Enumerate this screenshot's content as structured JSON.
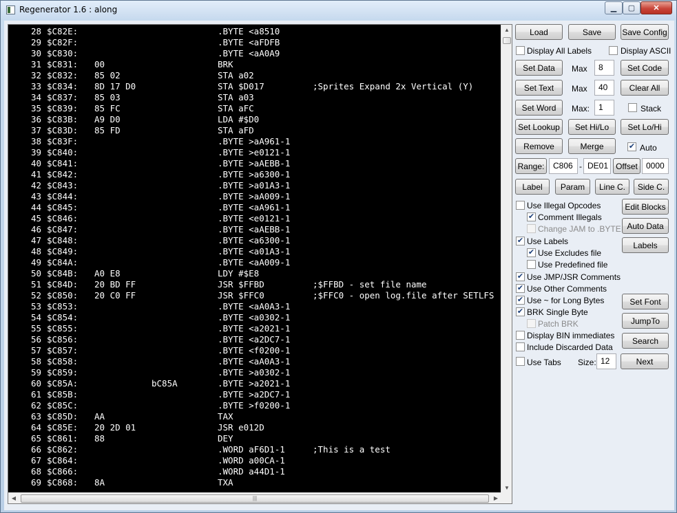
{
  "window": {
    "title": "Regenerator 1.6 : along",
    "min_glyph": "▁",
    "max_glyph": "▢",
    "close_glyph": "✕"
  },
  "code": {
    "lines": [
      {
        "num": "28",
        "addr": "$C82E:",
        "bytes": "",
        "label": "",
        "instr": ".BYTE <a8510",
        "comment": ""
      },
      {
        "num": "29",
        "addr": "$C82F:",
        "bytes": "",
        "label": "",
        "instr": ".BYTE <aFDFB",
        "comment": ""
      },
      {
        "num": "30",
        "addr": "$C830:",
        "bytes": "",
        "label": "",
        "instr": ".BYTE <aA0A9",
        "comment": ""
      },
      {
        "num": "31",
        "addr": "$C831:",
        "bytes": "00",
        "label": "",
        "instr": "BRK",
        "comment": ""
      },
      {
        "num": "32",
        "addr": "$C832:",
        "bytes": "85 02",
        "label": "",
        "instr": "STA a02",
        "comment": ""
      },
      {
        "num": "33",
        "addr": "$C834:",
        "bytes": "8D 17 D0",
        "label": "",
        "instr": "STA $D017",
        "comment": ";Sprites Expand 2x Vertical (Y)"
      },
      {
        "num": "34",
        "addr": "$C837:",
        "bytes": "85 03",
        "label": "",
        "instr": "STA a03",
        "comment": ""
      },
      {
        "num": "35",
        "addr": "$C839:",
        "bytes": "85 FC",
        "label": "",
        "instr": "STA aFC",
        "comment": ""
      },
      {
        "num": "36",
        "addr": "$C83B:",
        "bytes": "A9 D0",
        "label": "",
        "instr": "LDA #$D0",
        "comment": ""
      },
      {
        "num": "37",
        "addr": "$C83D:",
        "bytes": "85 FD",
        "label": "",
        "instr": "STA aFD",
        "comment": ""
      },
      {
        "num": "38",
        "addr": "$C83F:",
        "bytes": "",
        "label": "",
        "instr": ".BYTE >aA961-1",
        "comment": ""
      },
      {
        "num": "39",
        "addr": "$C840:",
        "bytes": "",
        "label": "",
        "instr": ".BYTE >e0121-1",
        "comment": ""
      },
      {
        "num": "40",
        "addr": "$C841:",
        "bytes": "",
        "label": "",
        "instr": ".BYTE >aAEBB-1",
        "comment": ""
      },
      {
        "num": "41",
        "addr": "$C842:",
        "bytes": "",
        "label": "",
        "instr": ".BYTE >a6300-1",
        "comment": ""
      },
      {
        "num": "42",
        "addr": "$C843:",
        "bytes": "",
        "label": "",
        "instr": ".BYTE >a01A3-1",
        "comment": ""
      },
      {
        "num": "43",
        "addr": "$C844:",
        "bytes": "",
        "label": "",
        "instr": ".BYTE >aA009-1",
        "comment": ""
      },
      {
        "num": "44",
        "addr": "$C845:",
        "bytes": "",
        "label": "",
        "instr": ".BYTE <aA961-1",
        "comment": ""
      },
      {
        "num": "45",
        "addr": "$C846:",
        "bytes": "",
        "label": "",
        "instr": ".BYTE <e0121-1",
        "comment": ""
      },
      {
        "num": "46",
        "addr": "$C847:",
        "bytes": "",
        "label": "",
        "instr": ".BYTE <aAEBB-1",
        "comment": ""
      },
      {
        "num": "47",
        "addr": "$C848:",
        "bytes": "",
        "label": "",
        "instr": ".BYTE <a6300-1",
        "comment": ""
      },
      {
        "num": "48",
        "addr": "$C849:",
        "bytes": "",
        "label": "",
        "instr": ".BYTE <a01A3-1",
        "comment": ""
      },
      {
        "num": "49",
        "addr": "$C84A:",
        "bytes": "",
        "label": "",
        "instr": ".BYTE <aA009-1",
        "comment": ""
      },
      {
        "num": "50",
        "addr": "$C84B:",
        "bytes": "A0 E8",
        "label": "",
        "instr": "LDY #$E8",
        "comment": ""
      },
      {
        "num": "51",
        "addr": "$C84D:",
        "bytes": "20 BD FF",
        "label": "",
        "instr": "JSR $FFBD",
        "comment": ";$FFBD - set file name"
      },
      {
        "num": "52",
        "addr": "$C850:",
        "bytes": "20 C0 FF",
        "label": "",
        "instr": "JSR $FFC0",
        "comment": ";$FFC0 - open log.file after SETLFS"
      },
      {
        "num": "53",
        "addr": "$C853:",
        "bytes": "",
        "label": "",
        "instr": ".BYTE <aA0A3-1",
        "comment": ""
      },
      {
        "num": "54",
        "addr": "$C854:",
        "bytes": "",
        "label": "",
        "instr": ".BYTE <a0302-1",
        "comment": ""
      },
      {
        "num": "55",
        "addr": "$C855:",
        "bytes": "",
        "label": "",
        "instr": ".BYTE <a2021-1",
        "comment": ""
      },
      {
        "num": "56",
        "addr": "$C856:",
        "bytes": "",
        "label": "",
        "instr": ".BYTE <a2DC7-1",
        "comment": ""
      },
      {
        "num": "57",
        "addr": "$C857:",
        "bytes": "",
        "label": "",
        "instr": ".BYTE <f0200-1",
        "comment": ""
      },
      {
        "num": "58",
        "addr": "$C858:",
        "bytes": "",
        "label": "",
        "instr": ".BYTE <aA0A3-1",
        "comment": ""
      },
      {
        "num": "59",
        "addr": "$C859:",
        "bytes": "",
        "label": "",
        "instr": ".BYTE >a0302-1",
        "comment": ""
      },
      {
        "num": "60",
        "addr": "$C85A:",
        "bytes": "",
        "label": "bC85A",
        "instr": ".BYTE >a2021-1",
        "comment": ""
      },
      {
        "num": "61",
        "addr": "$C85B:",
        "bytes": "",
        "label": "",
        "instr": ".BYTE >a2DC7-1",
        "comment": ""
      },
      {
        "num": "62",
        "addr": "$C85C:",
        "bytes": "",
        "label": "",
        "instr": ".BYTE >f0200-1",
        "comment": ""
      },
      {
        "num": "63",
        "addr": "$C85D:",
        "bytes": "AA",
        "label": "",
        "instr": "TAX",
        "comment": ""
      },
      {
        "num": "64",
        "addr": "$C85E:",
        "bytes": "20 2D 01",
        "label": "",
        "instr": "JSR e012D",
        "comment": ""
      },
      {
        "num": "65",
        "addr": "$C861:",
        "bytes": "88",
        "label": "",
        "instr": "DEY",
        "comment": ""
      },
      {
        "num": "66",
        "addr": "$C862:",
        "bytes": "",
        "label": "",
        "instr": ".WORD aF6D1-1",
        "comment": ";This is a test"
      },
      {
        "num": "67",
        "addr": "$C864:",
        "bytes": "",
        "label": "",
        "instr": ".WORD a00CA-1",
        "comment": ""
      },
      {
        "num": "68",
        "addr": "$C866:",
        "bytes": "",
        "label": "",
        "instr": ".WORD a44D1-1",
        "comment": ""
      },
      {
        "num": "69",
        "addr": "$C868:",
        "bytes": "8A",
        "label": "",
        "instr": "TXA",
        "comment": ""
      }
    ]
  },
  "panel": {
    "load": "Load",
    "save": "Save",
    "save_config": "Save Config",
    "display_all_labels": "Display All Labels",
    "display_ascii": "Display ASCII",
    "set_data": "Set Data",
    "max_label": "Max",
    "max_data": "8",
    "set_code": "Set Code",
    "set_text": "Set Text",
    "max_text": "40",
    "clear_all": "Clear All",
    "set_word": "Set Word",
    "max_colon_label": "Max:",
    "max_word": "1",
    "stack": "Stack",
    "set_lookup": "Set Lookup",
    "set_hilo": "Set Hi/Lo",
    "set_lohi": "Set Lo/Hi",
    "remove": "Remove",
    "merge": "Merge",
    "auto": "Auto",
    "range": "Range:",
    "range_from": "C806",
    "range_dash": "-",
    "range_to": "DE01",
    "offset": "Offset",
    "offset_value": "0000",
    "label": "Label",
    "param": "Param",
    "line_c": "Line C.",
    "side_c": "Side C.",
    "use_illegal_opcodes": "Use Illegal Opcodes",
    "comment_illegals": "Comment Illegals",
    "change_jam": "Change JAM to .BYTE",
    "edit_blocks": "Edit Blocks",
    "auto_data": "Auto Data",
    "use_labels": "Use Labels",
    "labels_btn": "Labels",
    "use_excludes": "Use Excludes file",
    "use_predefined": "Use Predefined file",
    "use_jmp_jsr": "Use JMP/JSR Comments",
    "use_other": "Use Other Comments",
    "use_tilde": "Use ~ for Long Bytes",
    "set_font": "Set Font",
    "brk_single": "BRK Single Byte",
    "jump_to": "JumpTo",
    "patch_brk": "Patch BRK",
    "display_bin": "Display BIN immediates",
    "search": "Search",
    "include_discarded": "Include Discarded Data",
    "use_tabs": "Use Tabs",
    "size_label": "Size:",
    "size_value": "12",
    "next": "Next"
  }
}
